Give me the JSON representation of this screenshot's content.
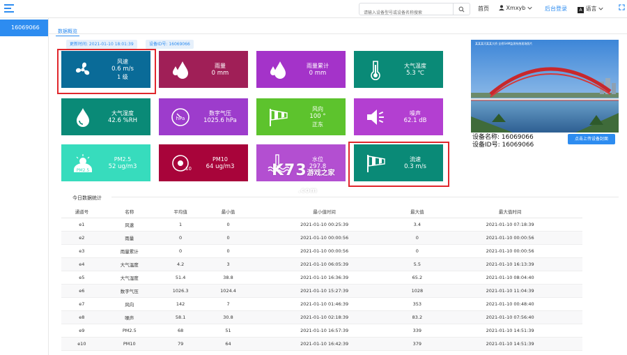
{
  "header": {
    "search_placeholder": "请输入设备型号或设备名称搜索",
    "home": "首页",
    "user": "Xmxyb",
    "dashboard": "后台登录",
    "language": "语言"
  },
  "sidebar": {
    "items": [
      {
        "label": "16069066"
      }
    ]
  },
  "tabs": [
    {
      "label": "数据概览"
    }
  ],
  "tags": {
    "update_time": "更新时间: 2021-01-10 18:01:39",
    "device_id": "设备ID号: 16069066"
  },
  "cards": [
    {
      "name": "风速",
      "value": "0.6 m/s",
      "extra": "1 级",
      "color": "#0a6b98",
      "icon": "fan-icon"
    },
    {
      "name": "雨量",
      "value": "0 mm",
      "extra": "",
      "color": "#a01f57",
      "icon": "raindrop-icon"
    },
    {
      "name": "雨量累计",
      "value": "0 mm",
      "extra": "",
      "color": "#a433c9",
      "icon": "raindrop-icon"
    },
    {
      "name": "大气温度",
      "value": "5.3 ℃",
      "extra": "",
      "color": "#0a8a77",
      "icon": "thermometer-icon"
    },
    {
      "name": "大气湿度",
      "value": "42.6 %RH",
      "extra": "",
      "color": "#0a8a77",
      "icon": "humidity-icon"
    },
    {
      "name": "数字气压",
      "value": "1025.6 hPa",
      "extra": "",
      "color": "#9d3ccc",
      "icon": "pressure-icon"
    },
    {
      "name": "风向",
      "value": "100 °",
      "extra": "正东",
      "color": "#5dc32d",
      "icon": "windsock-icon"
    },
    {
      "name": "噪声",
      "value": "62.1 dB",
      "extra": "",
      "color": "#b33fd1",
      "icon": "speaker-icon"
    },
    {
      "name": "PM2.5",
      "value": "52 ug/m3",
      "extra": "",
      "color": "#37dcbd",
      "icon": "pm25-icon"
    },
    {
      "name": "PM10",
      "value": "64 ug/m3",
      "extra": "",
      "color": "#a8043a",
      "icon": "pm10-icon"
    },
    {
      "name": "水位",
      "value": "297.8",
      "extra": "",
      "color": "#b34fd1",
      "icon": "water-level-icon"
    },
    {
      "name": "流速",
      "value": "0.3 m/s",
      "extra": "",
      "color": "#0a8a77",
      "icon": "windsock-icon"
    }
  ],
  "device": {
    "photo_caption": "某某某河某某大桥  全桥SHM监测系统现场照片",
    "name_line": "设备名称: 16069066",
    "id_line": "设备ID号: 16069066",
    "upload_label": "点击上传设备封面"
  },
  "stats": {
    "title": "今日数据统计",
    "headers": [
      "通道号",
      "名称",
      "平均值",
      "最小值",
      "最小值时间",
      "最大值",
      "最大值时间"
    ],
    "rows": [
      [
        "e1",
        "风速",
        "1",
        "0",
        "2021-01-10 00:25:39",
        "3.4",
        "2021-01-10 07:18:39"
      ],
      [
        "e2",
        "雨量",
        "0",
        "0",
        "2021-01-10 00:00:56",
        "0",
        "2021-01-10 00:00:56"
      ],
      [
        "e3",
        "雨量累计",
        "0",
        "0",
        "2021-01-10 00:00:56",
        "0",
        "2021-01-10 00:00:56"
      ],
      [
        "e4",
        "大气温度",
        "4.2",
        "3",
        "2021-01-10 06:05:39",
        "5.5",
        "2021-01-10 16:13:39"
      ],
      [
        "e5",
        "大气湿度",
        "51.4",
        "38.8",
        "2021-01-10 16:36:39",
        "65.2",
        "2021-01-10 08:04:40"
      ],
      [
        "e6",
        "数字气压",
        "1026.3",
        "1024.4",
        "2021-01-10 15:27:39",
        "1028",
        "2021-01-10 11:04:39"
      ],
      [
        "e7",
        "风向",
        "142",
        "7",
        "2021-01-10 01:46:39",
        "353",
        "2021-01-10 00:48:40"
      ],
      [
        "e8",
        "噪声",
        "58.1",
        "30.8",
        "2021-01-10 02:18:39",
        "83.2",
        "2021-01-10 07:56:40"
      ],
      [
        "e9",
        "PM2.5",
        "68",
        "51",
        "2021-01-10 16:57:39",
        "339",
        "2021-01-10 14:51:39"
      ],
      [
        "e10",
        "PM10",
        "79",
        "64",
        "2021-01-10 16:42:39",
        "379",
        "2021-01-10 14:51:39"
      ]
    ]
  },
  "watermark": {
    "brand": "K73",
    "sub": "游戏之家",
    "domain": ".com"
  }
}
